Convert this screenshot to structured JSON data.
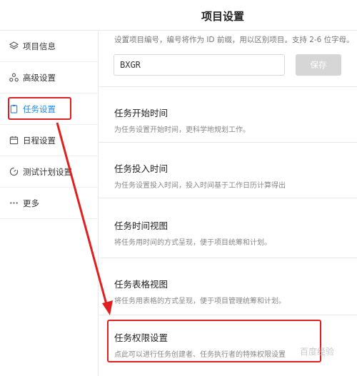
{
  "header": {
    "title": "项目设置"
  },
  "sidebar": {
    "items": [
      {
        "label": "项目信息",
        "icon": "layers-icon"
      },
      {
        "label": "高级设置",
        "icon": "nodes-icon"
      },
      {
        "label": "任务设置",
        "icon": "clipboard-icon",
        "active": true
      },
      {
        "label": "日程设置",
        "icon": "calendar-icon"
      },
      {
        "label": "测试计划设置",
        "icon": "gauge-icon"
      },
      {
        "label": "更多",
        "icon": "more-icon"
      }
    ]
  },
  "main": {
    "code_desc": "设置项目编号，编号将作为 ID 前缀，用以区别项目。支持 2-6 位字母。",
    "code_value": "BXGR",
    "save_label": "保存",
    "sections": [
      {
        "title": "任务开始时间",
        "desc": "为任务设置开始时间，更科学地规划工作。"
      },
      {
        "title": "任务投入时间",
        "desc": "为任务设置投入时间，投入时间基于工作日历计算得出"
      },
      {
        "title": "任务时间视图",
        "desc": "将任务用时间的方式呈现，便于项目统筹和计划。"
      },
      {
        "title": "任务表格视图",
        "desc": "将任务用表格的方式呈现，便于项目管理统筹和计划。"
      },
      {
        "title": "任务权限设置",
        "desc": "点此可以进行任务创建者、任务执行者的特殊权限设置"
      }
    ]
  },
  "colors": {
    "accent": "#1e88e5",
    "annotation": "#e02020",
    "disabled_button": "#d6d6d6"
  },
  "watermark": "百度经验"
}
